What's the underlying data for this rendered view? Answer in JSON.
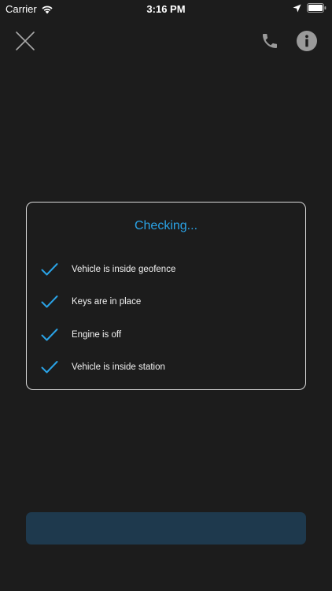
{
  "status_bar": {
    "carrier": "Carrier",
    "time": "3:16 PM",
    "icons": [
      "wifi-icon",
      "location-arrow-icon",
      "battery-icon"
    ]
  },
  "nav": {
    "close_icon": "close-icon",
    "phone_icon": "phone-icon",
    "info_icon": "info-icon"
  },
  "card": {
    "title": "Checking...",
    "items": [
      {
        "label": "Vehicle is inside geofence",
        "status": "checked"
      },
      {
        "label": "Keys are in place",
        "status": "checked"
      },
      {
        "label": "Engine is off",
        "status": "checked"
      },
      {
        "label": "Vehicle is inside station",
        "status": "checked"
      }
    ]
  },
  "action_button": {
    "label": ""
  },
  "colors": {
    "background": "#1c1c1c",
    "accent": "#2aa3e6",
    "card_border": "#d9d9d9",
    "button_bg": "#1e394d",
    "icon_gray": "#9a9a9a"
  }
}
